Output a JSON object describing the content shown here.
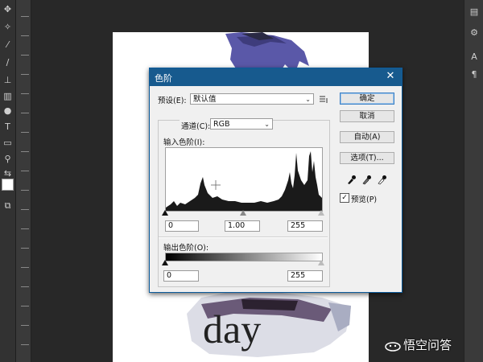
{
  "dialog": {
    "title": "色阶",
    "close_glyph": "✕",
    "preset_label": "预设(E):",
    "preset_value": "默认值",
    "channel_label": "通道(C):",
    "channel_value": "RGB",
    "input_levels_label": "输入色阶(I):",
    "input_black": "0",
    "input_gamma": "1.00",
    "input_white": "255",
    "output_levels_label": "输出色阶(O):",
    "output_black": "0",
    "output_white": "255",
    "buttons": {
      "ok": "确定",
      "cancel": "取消",
      "auto": "自动(A)",
      "options": "选项(T)..."
    },
    "preview_label": "预览(P)",
    "preview_checked": true,
    "preview_check_glyph": "✓",
    "caret_glyph": "⌄"
  },
  "canvas": {
    "caption": "day"
  },
  "watermark": {
    "text": "悟空问答"
  },
  "tools": [
    "move-icon",
    "marquee-icon",
    "lasso-icon",
    "magic-wand-icon",
    "crop-icon",
    "eyedropper-icon",
    "healing-icon",
    "brush-icon",
    "stamp-icon",
    "history-brush-icon",
    "eraser-icon",
    "gradient-icon",
    "dodge-icon",
    "pen-icon",
    "type-icon",
    "path-select-icon",
    "shape-icon",
    "hand-icon",
    "zoom-icon"
  ],
  "histogram_note": "luminance histogram with peaks near right side",
  "colors": {
    "titlebar": "#175a8e",
    "workspace": "#282828",
    "dialog_bg": "#f0f0f0"
  }
}
